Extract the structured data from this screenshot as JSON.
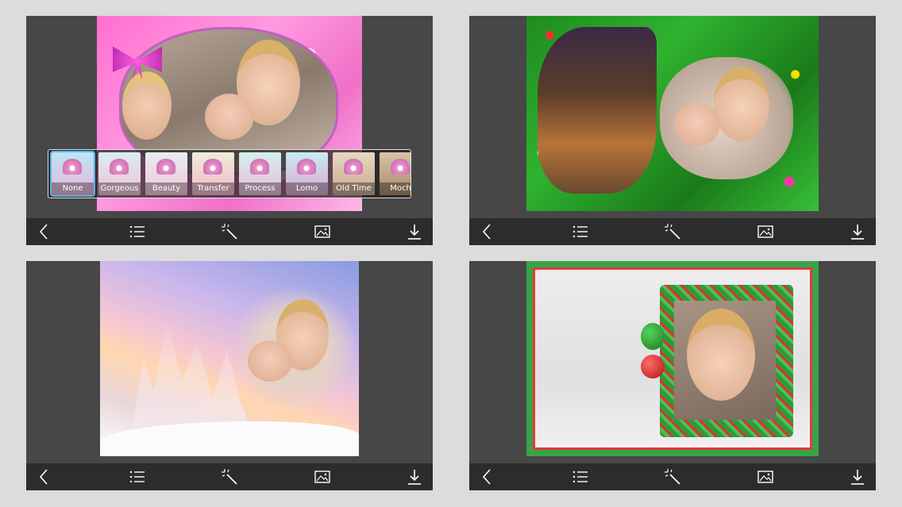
{
  "colors": {
    "page_bg": "#dcdcdc",
    "panel_bg": "#474748",
    "toolbar_bg": "#2c2c2d",
    "icon": "#ffffff",
    "filter_selected": "#5ab0f0"
  },
  "toolbar_icons": [
    "back-chevron-icon",
    "list-icon",
    "magic-wand-icon",
    "image-icon",
    "download-icon"
  ],
  "filters": {
    "items": [
      {
        "label": "None",
        "selected": true
      },
      {
        "label": "Gorgeous",
        "selected": false
      },
      {
        "label": "Beauty",
        "selected": false
      },
      {
        "label": "Transfer",
        "selected": false
      },
      {
        "label": "Process",
        "selected": false
      },
      {
        "label": "Lomo",
        "selected": false
      },
      {
        "label": "Old Time",
        "selected": false
      },
      {
        "label": "Moch",
        "selected": false
      }
    ]
  },
  "screens": [
    {
      "frame": "pink-snowflake-heart-frame"
    },
    {
      "frame": "christmas-garland-frame"
    },
    {
      "frame": "winter-forest-blend"
    },
    {
      "frame": "christmas-wreath-square-frame"
    }
  ]
}
